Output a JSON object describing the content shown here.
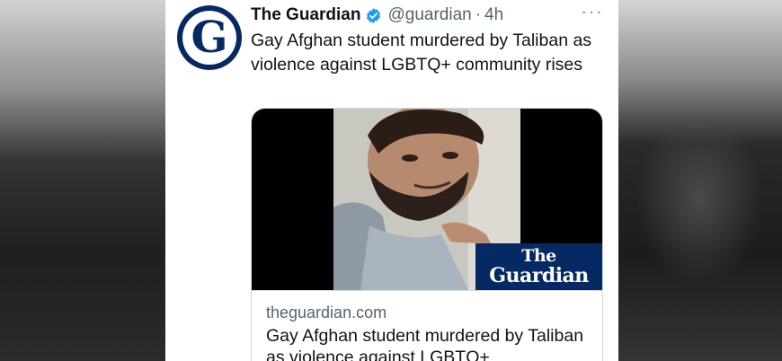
{
  "tweet": {
    "display_name": "The Guardian",
    "handle": "@guardian",
    "separator": "·",
    "time": "4h",
    "more_icon": "more-icon",
    "text": "Gay Afghan student murdered by Taliban as violence against LGBTQ+ community rises",
    "avatar_letter": "G",
    "avatar_color": "#052962"
  },
  "card": {
    "logo_the": "The",
    "logo_guardian": "Guardian",
    "logo_color": "#052962",
    "domain": "theguardian.com",
    "title": "Gay Afghan student murdered by Taliban as violence against LGBTQ+"
  },
  "colors": {
    "verified": "#1d9bf0",
    "secondary_text": "#536471",
    "primary_text": "#0f1419"
  }
}
